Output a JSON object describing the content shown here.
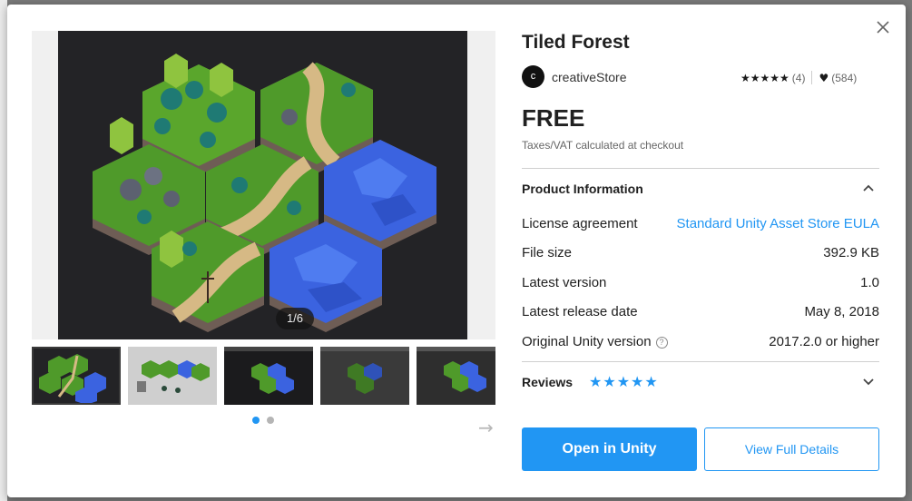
{
  "asset": {
    "title": "Tiled Forest",
    "publisher_initial": "c",
    "publisher_name": "creativeStore",
    "rating_stars": "★★★★★",
    "rating_count": "(4)",
    "favorites_count": "(584)",
    "price": "FREE",
    "tax_note": "Taxes/VAT calculated at checkout"
  },
  "gallery": {
    "counter": "1/6",
    "thumbnail_count": 5,
    "page_dots": 2,
    "active_dot": 0
  },
  "product_info": {
    "header": "Product Information",
    "rows": [
      {
        "label": "License agreement",
        "value": "Standard Unity Asset Store EULA",
        "is_link": true
      },
      {
        "label": "File size",
        "value": "392.9 KB"
      },
      {
        "label": "Latest version",
        "value": "1.0"
      },
      {
        "label": "Latest release date",
        "value": "May 8, 2018"
      },
      {
        "label": "Original Unity version",
        "value": "2017.2.0 or higher",
        "has_help": true
      }
    ]
  },
  "reviews": {
    "label": "Reviews",
    "stars": "★★★★★"
  },
  "actions": {
    "primary_label": "Open in Unity",
    "secondary_label": "View Full Details"
  },
  "colors": {
    "accent": "#2196f3",
    "grass": "#4f9a2a",
    "water": "#3b63e0",
    "path": "#d6b985"
  }
}
